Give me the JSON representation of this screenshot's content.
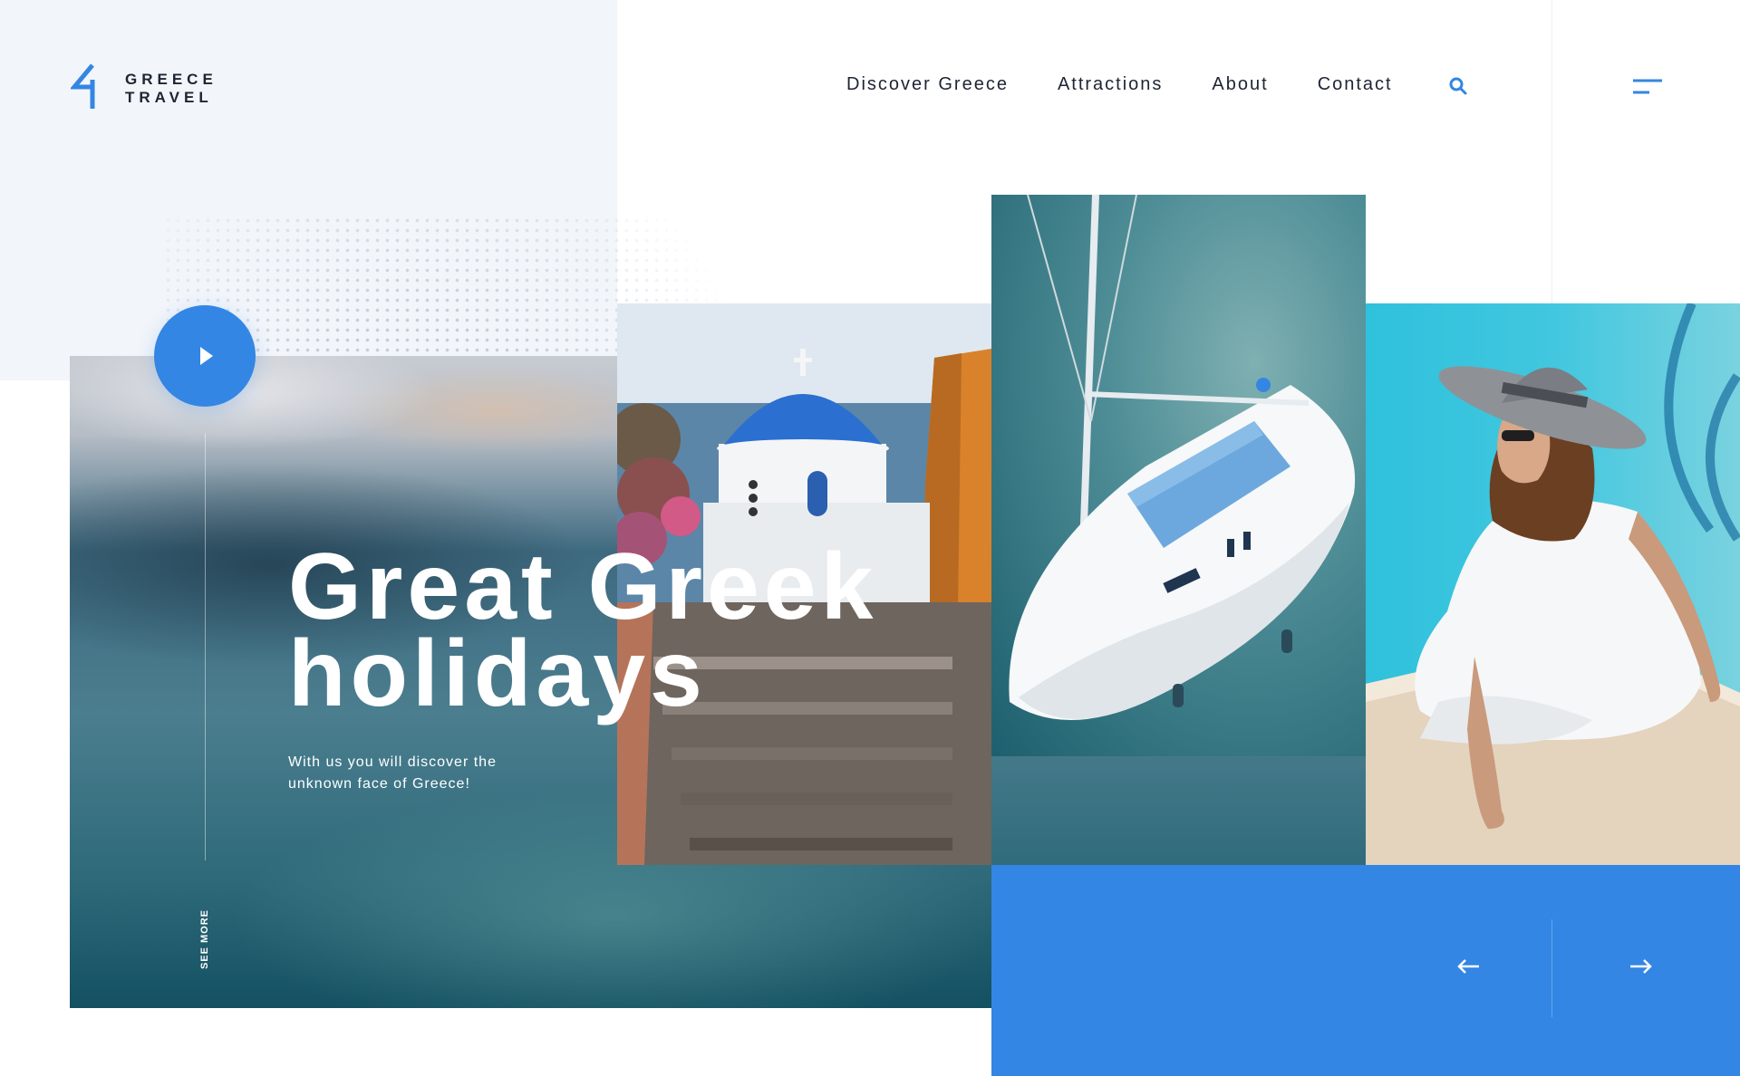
{
  "brand": {
    "line1": "GREECE",
    "line2": "TRAVEL",
    "accent_color": "#3386e3"
  },
  "nav": {
    "items": [
      "Discover Greece",
      "Attractions",
      "About",
      "Contact"
    ],
    "search_icon": "search-icon",
    "menu_icon": "hamburger-menu-icon"
  },
  "hero": {
    "title_line1": "Great Greek",
    "title_line2": "holidays",
    "subtitle_line1": "With us you will discover the",
    "subtitle_line2": "unknown face of Greece!",
    "see_more": "SEE MORE",
    "play_icon": "play-icon"
  },
  "gallery": {
    "photos": [
      "santorini-church-photo",
      "sailing-yacht-photo",
      "woman-by-pool-photo"
    ]
  },
  "slider_controls": {
    "prev_icon": "arrow-left-icon",
    "next_icon": "arrow-right-icon"
  }
}
